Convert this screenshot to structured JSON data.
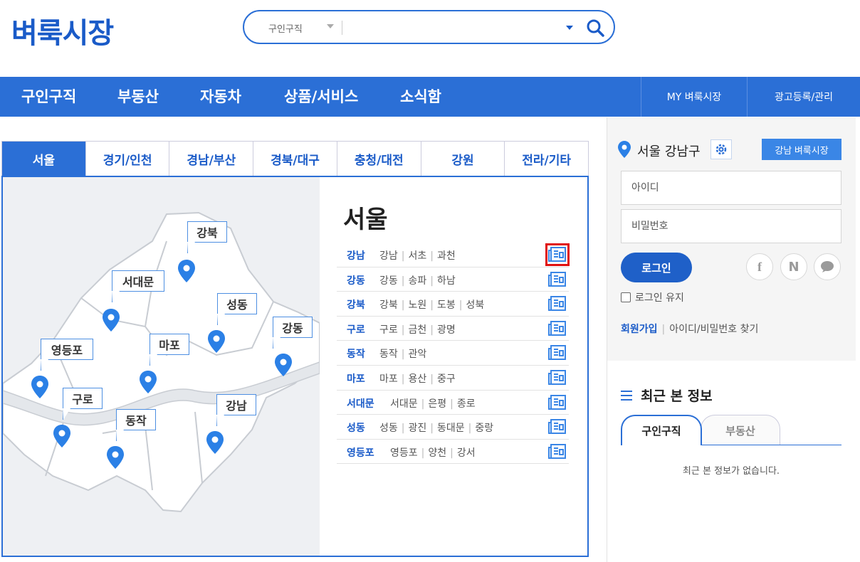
{
  "header": {
    "logo": "벼룩시장",
    "search": {
      "category": "구인구직",
      "value": "",
      "placeholder": ""
    }
  },
  "nav": {
    "items": [
      "구인구직",
      "부동산",
      "자동차",
      "상품/서비스",
      "소식함"
    ],
    "right": [
      "MY 벼룩시장",
      "광고등록/관리"
    ]
  },
  "region_tabs": [
    "서울",
    "경기/인천",
    "경남/부산",
    "경북/대구",
    "충청/대전",
    "강원",
    "전라/기타"
  ],
  "active_region": "서울",
  "map_labels": [
    "강북",
    "서대문",
    "성동",
    "강동",
    "영등포",
    "마포",
    "구로",
    "동작",
    "강남"
  ],
  "region": {
    "title": "서울",
    "districts": [
      {
        "name": "강남",
        "subs": [
          "강남",
          "서초",
          "과천"
        ]
      },
      {
        "name": "강동",
        "subs": [
          "강동",
          "송파",
          "하남"
        ]
      },
      {
        "name": "강북",
        "subs": [
          "강북",
          "노원",
          "도봉",
          "성북"
        ]
      },
      {
        "name": "구로",
        "subs": [
          "구로",
          "금천",
          "광명"
        ]
      },
      {
        "name": "동작",
        "subs": [
          "동작",
          "관악"
        ]
      },
      {
        "name": "마포",
        "subs": [
          "마포",
          "용산",
          "중구"
        ]
      },
      {
        "name": "서대문",
        "subs": [
          "서대문",
          "은평",
          "종로"
        ]
      },
      {
        "name": "성동",
        "subs": [
          "성동",
          "광진",
          "동대문",
          "중랑"
        ]
      },
      {
        "name": "영등포",
        "subs": [
          "영등포",
          "양천",
          "강서"
        ]
      }
    ]
  },
  "sidebar": {
    "location": "서울 강남구",
    "local_button": "강남 벼룩시장",
    "id_placeholder": "아이디",
    "pw_placeholder": "비밀번호",
    "login_button": "로그인",
    "social": [
      "f",
      "N",
      "talk"
    ],
    "keep_login": "로그인 유지",
    "join": "회원가입",
    "find": "아이디/비밀번호 찾기",
    "recent": {
      "title": "최근 본 정보",
      "tabs": [
        "구인구직",
        "부동산"
      ],
      "empty": "최근 본 정보가 없습니다."
    }
  },
  "colors": {
    "brand": "#2b6fd6",
    "logo": "#1a5bc8",
    "highlight": "#e01010"
  }
}
